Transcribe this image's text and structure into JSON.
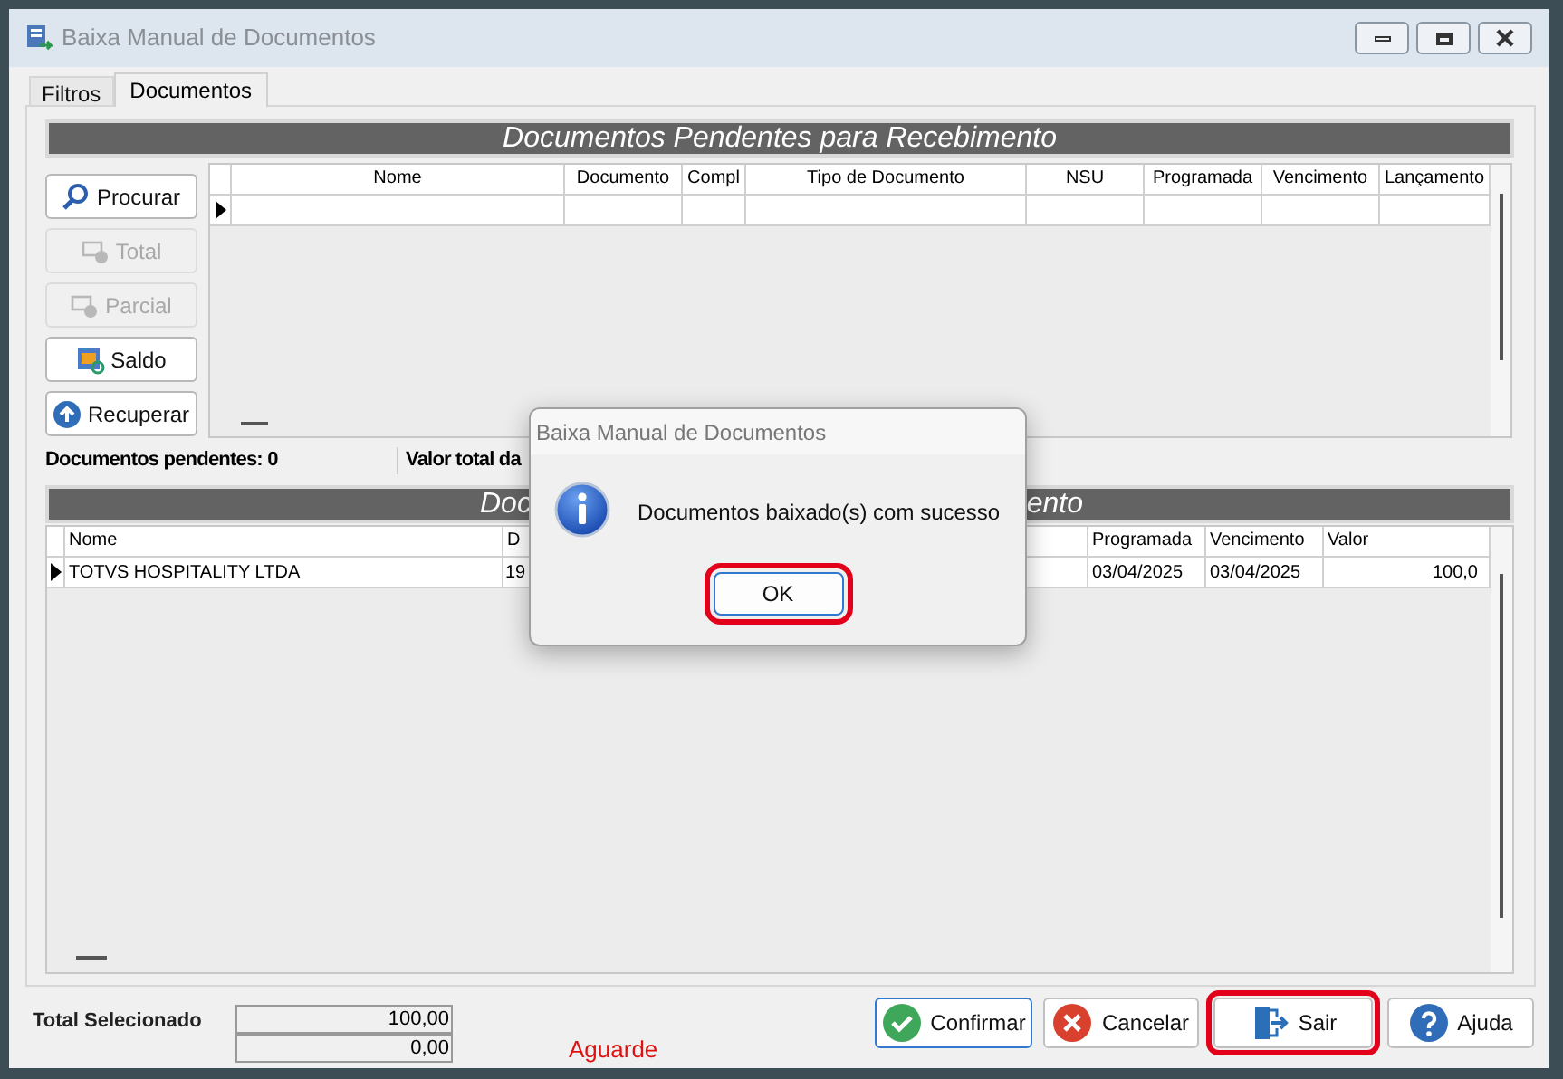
{
  "window": {
    "title": "Baixa Manual de Documentos"
  },
  "tabs": [
    {
      "label": "Filtros",
      "selected": false
    },
    {
      "label": "Documentos",
      "selected": true
    }
  ],
  "pending": {
    "title": "Documentos Pendentes para Recebimento",
    "actions": [
      {
        "label": "Procurar",
        "kind": "search",
        "disabled": false
      },
      {
        "label": "Total",
        "kind": "total",
        "disabled": true
      },
      {
        "label": "Parcial",
        "kind": "partial",
        "disabled": true
      },
      {
        "label": "Saldo",
        "kind": "balance",
        "disabled": false
      },
      {
        "label": "Recuperar",
        "kind": "restore",
        "disabled": false
      }
    ],
    "table": {
      "columns": [
        "Nome",
        "Documento",
        "Compl",
        "Tipo de Documento",
        "NSU",
        "Programada",
        "Vencimento",
        "Lançamento"
      ],
      "rows": [
        {
          "selected": true
        }
      ]
    }
  },
  "summary": {
    "pending_count": "Documentos pendentes: 0",
    "total": "Valor total da"
  },
  "selected_docs": {
    "title_parts": [
      "Doc",
      "ento"
    ],
    "table": {
      "columns": [
        "Nome",
        "D",
        "Programada",
        "Vencimento",
        "Valor"
      ],
      "rows": [
        {
          "selected": true,
          "cells": [
            "TOTVS HOSPITALITY LTDA",
            "19",
            "03/04/2025",
            "03/04/2025",
            "100,0"
          ]
        }
      ]
    }
  },
  "footer": {
    "total_label": "Total Selecionado",
    "totals": [
      "100,00",
      "0,00"
    ],
    "status": "Aguarde",
    "buttons": [
      {
        "label": "Confirmar",
        "kind": "confirm",
        "focused": true,
        "highlighted": false
      },
      {
        "label": "Cancelar",
        "kind": "cancel",
        "focused": false,
        "highlighted": false
      },
      {
        "label": "Sair",
        "kind": "exit",
        "focused": false,
        "highlighted": true
      },
      {
        "label": "Ajuda",
        "kind": "help",
        "focused": false,
        "highlighted": false
      }
    ]
  },
  "dialog": {
    "title": "Baixa Manual de Documentos",
    "message": "Documentos baixado(s) com sucesso",
    "button": {
      "label": "OK",
      "highlighted": true
    }
  }
}
